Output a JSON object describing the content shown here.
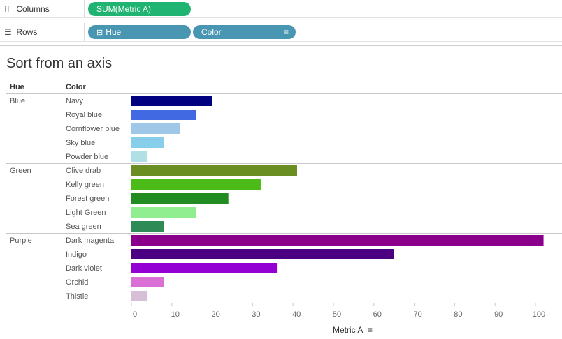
{
  "shelves": {
    "columns": {
      "label": "Columns",
      "icon": "columns-icon",
      "pill": "SUM(Metric A)",
      "pill_color": "#1fb471"
    },
    "rows": {
      "label": "Rows",
      "icon": "rows-icon",
      "pills": [
        {
          "label": "Hue",
          "prefix": "⊟",
          "color": "#4996b2"
        },
        {
          "label": "Color",
          "color": "#4996b2",
          "sort_icon": "sort-descending-icon"
        }
      ]
    }
  },
  "view_title": "Sort from an axis",
  "headers": {
    "hue": "Hue",
    "color": "Color"
  },
  "axis": {
    "label": "Metric A",
    "sort_icon": "sort-descending-icon"
  },
  "chart_data": {
    "type": "bar",
    "orientation": "horizontal",
    "title": "Sort from an axis",
    "xlabel": "Metric A",
    "xlim": [
      0,
      102
    ],
    "xticks": [
      0,
      10,
      20,
      30,
      40,
      50,
      60,
      70,
      80,
      90,
      100
    ],
    "groups": [
      {
        "hue": "Blue",
        "items": [
          {
            "label": "Navy",
            "value": 20,
            "color": "#000080"
          },
          {
            "label": "Royal blue",
            "value": 16,
            "color": "#4169e1"
          },
          {
            "label": "Cornflower blue",
            "value": 12,
            "color": "#9fc8e8"
          },
          {
            "label": "Sky blue",
            "value": 8,
            "color": "#87ceeb"
          },
          {
            "label": "Powder blue",
            "value": 4,
            "color": "#b0e0e6"
          }
        ]
      },
      {
        "hue": "Green",
        "items": [
          {
            "label": "Olive drab",
            "value": 41,
            "color": "#6b8e23"
          },
          {
            "label": "Kelly green",
            "value": 32,
            "color": "#4cbb17"
          },
          {
            "label": "Forest green",
            "value": 24,
            "color": "#228b22"
          },
          {
            "label": "Light Green",
            "value": 16,
            "color": "#90ee90"
          },
          {
            "label": "Sea green",
            "value": 8,
            "color": "#2e8b57"
          }
        ]
      },
      {
        "hue": "Purple",
        "items": [
          {
            "label": "Dark magenta",
            "value": 102,
            "color": "#8b008b"
          },
          {
            "label": "Indigo",
            "value": 65,
            "color": "#4b0082"
          },
          {
            "label": "Dark violet",
            "value": 36,
            "color": "#9400d3"
          },
          {
            "label": "Orchid",
            "value": 8,
            "color": "#da70d6"
          },
          {
            "label": "Thistle",
            "value": 4,
            "color": "#d8bfd8"
          }
        ]
      }
    ],
    "grid": false,
    "legend": "none"
  }
}
